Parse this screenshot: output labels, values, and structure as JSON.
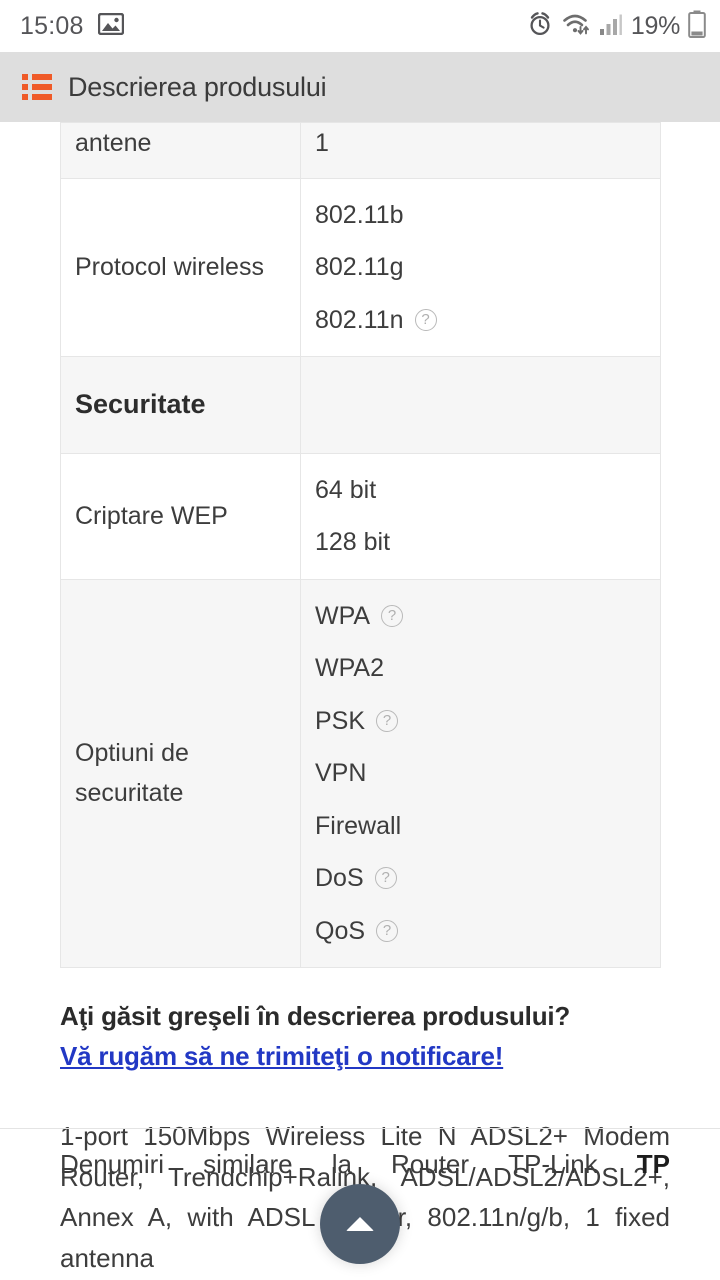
{
  "status_bar": {
    "time": "15:08",
    "battery_percent": "19%",
    "icons": [
      "photo-icon",
      "alarm-icon",
      "wifi-icon",
      "signal-icon",
      "battery-icon"
    ]
  },
  "header": {
    "title": "Descrierea produsului",
    "icon": "list-icon",
    "icon_color": "#ef5a28",
    "background": "#dedede"
  },
  "spec_table": {
    "rows": [
      {
        "label": "antene",
        "values": [
          {
            "text": "1",
            "help": false
          }
        ],
        "shaded": true,
        "clipped": true,
        "section": false
      },
      {
        "label": "Protocol wireless",
        "values": [
          {
            "text": "802.11b",
            "help": false
          },
          {
            "text": "802.11g",
            "help": false
          },
          {
            "text": "802.11n",
            "help": true
          }
        ],
        "shaded": false,
        "clipped": false,
        "section": false
      },
      {
        "label": "Securitate",
        "values": [],
        "shaded": true,
        "clipped": false,
        "section": true
      },
      {
        "label": "Criptare WEP",
        "values": [
          {
            "text": "64 bit",
            "help": false
          },
          {
            "text": "128 bit",
            "help": false
          }
        ],
        "shaded": false,
        "clipped": false,
        "section": false
      },
      {
        "label": "Optiuni de securitate",
        "values": [
          {
            "text": "WPA",
            "help": true
          },
          {
            "text": "WPA2",
            "help": false
          },
          {
            "text": "PSK",
            "help": true
          },
          {
            "text": "VPN",
            "help": false
          },
          {
            "text": "Firewall",
            "help": false
          },
          {
            "text": "DoS",
            "help": true
          },
          {
            "text": "QoS",
            "help": true
          }
        ],
        "shaded": true,
        "clipped": false,
        "section": false
      }
    ],
    "help_glyph": "?"
  },
  "feedback": {
    "question": "Aţi găsit greşeli în descrierea produsului?",
    "link_label": "Vă rugăm să ne trimiteţi o notificare!",
    "link_color": "#2238c4"
  },
  "description": {
    "text": "1-port 150Mbps Wireless Lite N ADSL2+ Modem Router, Trendchip+Ralink, ADSL/ADSL2/ADSL2+, Annex A, with ADSL splitter, 802.11n/g/b, 1 fixed antenna"
  },
  "bottom_clipped": {
    "words": [
      "Denumiri",
      "similare",
      "la",
      "Router",
      "TP-Link"
    ],
    "bold_tail": "TP"
  },
  "fab": {
    "name": "scroll-to-top",
    "glyph": "▲",
    "color": "#4e5d6e"
  }
}
